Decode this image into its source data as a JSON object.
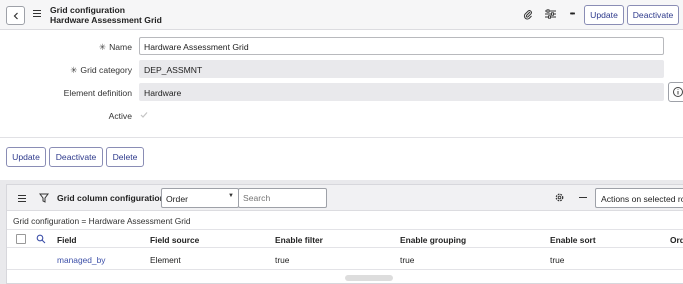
{
  "header": {
    "title_line1": "Grid configuration",
    "title_line2": "Hardware Assessment Grid",
    "update_label": "Update",
    "deactivate_label": "Deactivate",
    "more_glyph": "•••"
  },
  "form": {
    "name_label": "Name",
    "name_value": "Hardware Assessment Grid",
    "category_label": "Grid category",
    "category_value": "DEP_ASSMNT",
    "element_label": "Element definition",
    "element_value": "Hardware",
    "active_label": "Active",
    "required_marker": "✳"
  },
  "actions": {
    "update_label": "Update",
    "deactivate_label": "Deactivate",
    "delete_label": "Delete"
  },
  "related_list": {
    "title": "Grid column configurations",
    "sort_select": "Order",
    "search_placeholder": "Search",
    "actions_select": "Actions on selected rows",
    "breadcrumb": "Grid configuration = Hardware Assessment Grid",
    "columns": [
      "Field",
      "Field source",
      "Enable filter",
      "Enable grouping",
      "Enable sort",
      "Ord"
    ],
    "rows": [
      {
        "field": "managed_by",
        "field_source": "Element",
        "enable_filter": "true",
        "enable_grouping": "true",
        "enable_sort": "true"
      }
    ]
  },
  "colors": {
    "accent": "#2e3a8c",
    "link": "#3c4fa8"
  }
}
